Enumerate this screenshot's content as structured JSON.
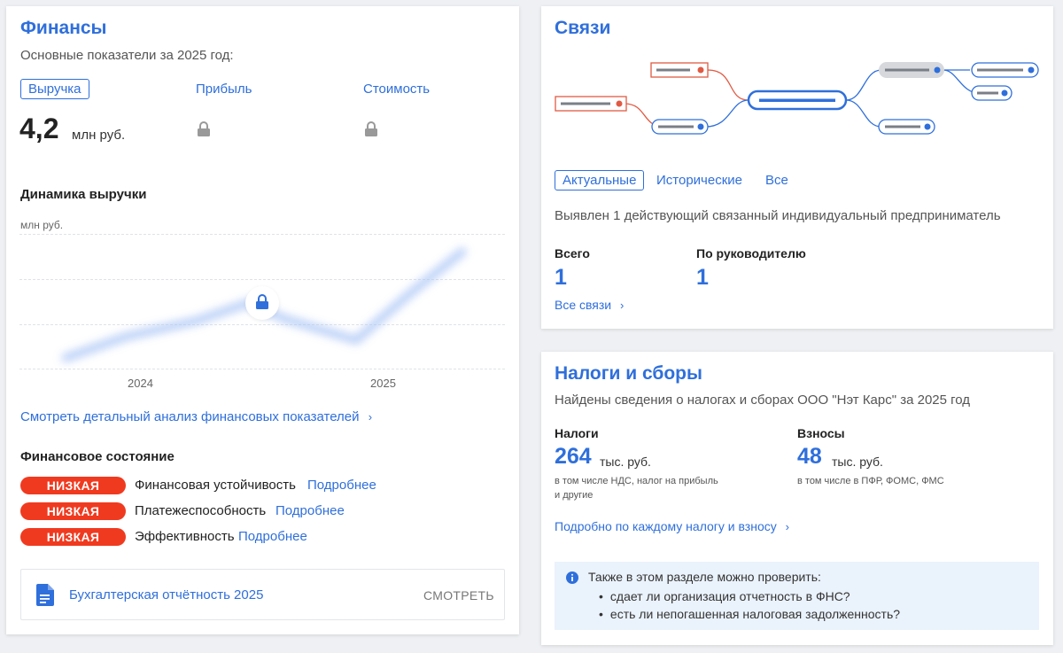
{
  "finance": {
    "title": "Финансы",
    "subtitle": "Основные показатели за 2025 год:",
    "tabs": [
      "Выручка",
      "Прибыль",
      "Стоимость"
    ],
    "revenue_value": "4,2",
    "revenue_unit": "млн руб.",
    "chart_title": "Динамика выручки",
    "chart_unit": "млн руб.",
    "chart_years": [
      "2024",
      "2025"
    ],
    "analysis_link": "Смотреть детальный анализ финансовых показателей",
    "state_title": "Финансовое состояние",
    "state_rows": [
      {
        "badge": "НИЗКАЯ",
        "name": "Финансовая устойчивость",
        "link": "Подробнее"
      },
      {
        "badge": "НИЗКАЯ",
        "name": "Платежеспособность",
        "link": "Подробнее"
      },
      {
        "badge": "НИЗКАЯ",
        "name": "Эффективность",
        "link": "Подробнее"
      }
    ],
    "report_label": "Бухгалтерская отчётность 2025",
    "report_action": "СМОТРЕТЬ"
  },
  "links": {
    "title": "Связи",
    "tabs": [
      "Актуальные",
      "Исторические",
      "Все"
    ],
    "summary": "Выявлен 1 действующий связанный индивидуальный предприниматель",
    "total_label": "Всего",
    "total_value": "1",
    "by_head_label": "По руководителю",
    "by_head_value": "1",
    "all_link": "Все связи"
  },
  "taxes": {
    "title": "Налоги и сборы",
    "subtitle": "Найдены сведения о налогах и сборах ООО \"Нэт Карс\" за 2025 год",
    "taxes_label": "Налоги",
    "taxes_value": "264",
    "taxes_unit": "тыс. руб.",
    "taxes_note_1": "в том числе НДС, налог на прибыль",
    "taxes_note_2": "и другие",
    "contrib_label": "Взносы",
    "contrib_value": "48",
    "contrib_unit": "тыс. руб.",
    "contrib_note": "в том числе в ПФР, ФОМС, ФМС",
    "detail_link": "Подробно по каждому налогу и взносу",
    "info_title": "Также в этом разделе можно проверить:",
    "info_items": [
      "сдает ли организация отчетность в ФНС?",
      "есть ли непогашенная налоговая задолженность?"
    ]
  },
  "colors": {
    "accent": "#2f6fdb",
    "danger": "#f03a1f",
    "link_red": "#e05a43",
    "info_bg": "#eaf2fb"
  }
}
